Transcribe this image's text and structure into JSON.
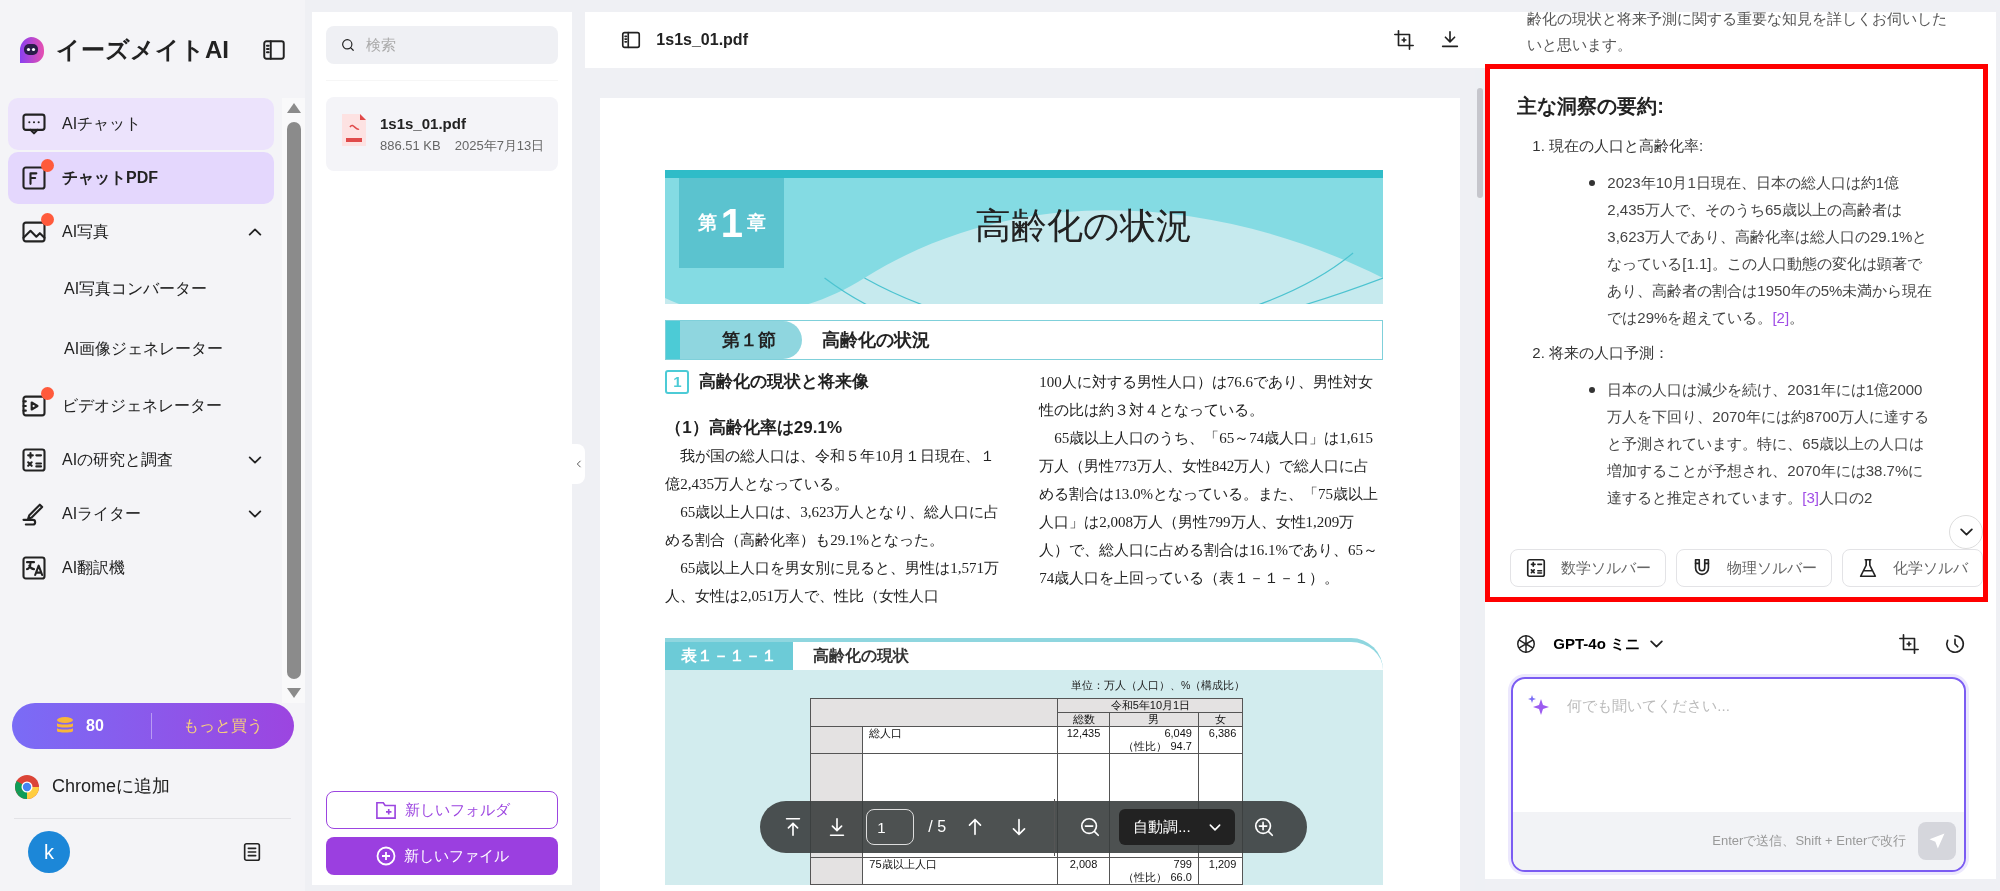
{
  "sidebar": {
    "brand": "イーズメイトAI",
    "items": [
      {
        "label": "AIチャット",
        "kind": "link",
        "selected": false,
        "hovered": true,
        "hot": false
      },
      {
        "label": "チャットPDF",
        "kind": "link",
        "selected": true,
        "hovered": false,
        "hot": true
      },
      {
        "label": "AI写真",
        "kind": "group",
        "selected": false,
        "hovered": false,
        "hot": true,
        "expanded": true,
        "children": [
          {
            "label": "AI写真コンバーター"
          },
          {
            "label": "AI画像ジェネレーター"
          }
        ]
      },
      {
        "label": "ビデオジェネレーター",
        "kind": "link",
        "selected": false,
        "hovered": false,
        "hot": true
      },
      {
        "label": "AIの研究と調査",
        "kind": "group",
        "selected": false,
        "hovered": false,
        "hot": false,
        "expanded": false
      },
      {
        "label": "AIライター",
        "kind": "group",
        "selected": false,
        "hovered": false,
        "hot": false,
        "expanded": false
      },
      {
        "label": "AI翻訳機",
        "kind": "link",
        "selected": false,
        "hovered": false,
        "hot": false
      }
    ],
    "credits": {
      "count": "80",
      "action": "もっと買う"
    },
    "extension": "Chromeに追加",
    "avatar": "k"
  },
  "files": {
    "search": {
      "placeholder": "検索"
    },
    "items": [
      {
        "name": "1s1s_01.pdf",
        "size": "886.51 KB",
        "date": "2025年7月13日"
      }
    ],
    "buttons": [
      "新しいフォルダ",
      "新しいファイル"
    ]
  },
  "viewer": {
    "title": "1s1s_01.pdf",
    "document": {
      "chapter": {
        "pre": "第",
        "num": "1",
        "post": "章",
        "title": "高齢化の状況"
      },
      "section": {
        "label": "第１節",
        "title": "高齢化の状況"
      },
      "subsection": {
        "num": "1",
        "title": "高齢化の現状と将来像"
      },
      "heading": "（1）高齢化率は29.1%",
      "left": [
        {
          "text": "我が国の総人口は、令和５年10月１日現在、１億2,435万人となっている。",
          "indent": true
        },
        {
          "text": "65歳以上人口は、3,623万人となり、総人口に占める割合（高齢化率）も29.1%となった。",
          "indent": true
        },
        {
          "text": "65歳以上人口を男女別に見ると、男性は1,571万人、女性は2,051万人で、性比（女性人口",
          "indent": true
        }
      ],
      "right": [
        {
          "text": "100人に対する男性人口）は76.6であり、男性対女性の比は約３対４となっている。",
          "indent": false
        },
        {
          "text": "65歳以上人口のうち、「65～74歳人口」は1,615万人（男性773万人、女性842万人）で総人口に占める割合は13.0%となっている。また、「75歳以上人口」は2,008万人（男性799万人、女性1,209万人）で、総人口に占める割合は16.1%であり、65～74歳人口を上回っている（表１－１－１）。",
          "indent": true
        }
      ],
      "table": {
        "label": "表１－１－１",
        "title": "高齢化の現状",
        "unit": "単位：万人（人口）、%（構成比）",
        "period": "令和5年10月1日",
        "columns": [
          "総数",
          "男",
          "女"
        ],
        "rows": [
          {
            "label": "総人口",
            "values": [
              "12,435",
              "6,049",
              "6,386"
            ],
            "ratio_label": "（性比）",
            "ratio": "94.7"
          },
          {
            "label": "75歳以上人口",
            "values": [
              "2,008",
              "799",
              "1,209"
            ],
            "ratio_label": "（性比）",
            "ratio": "66.0"
          }
        ]
      }
    },
    "toolbar": {
      "page": "1",
      "total": "/ 5",
      "zoom": "自動調..."
    }
  },
  "chat": {
    "intro": "齢化の現状と将来予測に関する重要な知見を詳しくお伺いしたいと思います。",
    "answer": {
      "title": "主な洞察の要約:",
      "sections": [
        {
          "num": "1.",
          "title": "現在の人口と高齢化率:",
          "bullets": [
            [
              {
                "kind": "text",
                "text": "2023年10月1日現在、日本の総人口は約1億2,435万人で、そのうち65歳以上の高齢者は3,623万人であり、高齢化率は総人口の29.1%となっている[1.1]。この人口動態の変化は顕著であり、高齢者の割合は1950年の5%未満から現在では29%を超えている。"
              },
              {
                "kind": "cite",
                "text": "[2]"
              },
              {
                "kind": "text",
                "text": "。"
              }
            ]
          ]
        },
        {
          "num": "2.",
          "title": "将来の人口予測：",
          "bullets": [
            [
              {
                "kind": "text",
                "text": "日本の人口は減少を続け、2031年には1億2000万人を下回り、2070年には約8700万人に達すると予測されています。特に、65歳以上の人口は増加することが予想され、2070年には38.7%に達すると推定されています。"
              },
              {
                "kind": "cite",
                "text": "[3]"
              },
              {
                "kind": "text",
                "text": "人口の2"
              }
            ]
          ]
        }
      ]
    },
    "tools": [
      "数学ソルバー",
      "物理ソルバー",
      "化学ソルバ"
    ],
    "model": "GPT-4o ミニ",
    "input": {
      "placeholder": "何でも聞いてください..."
    },
    "hint": "Enterで送信、Shift + Enterで改行"
  }
}
